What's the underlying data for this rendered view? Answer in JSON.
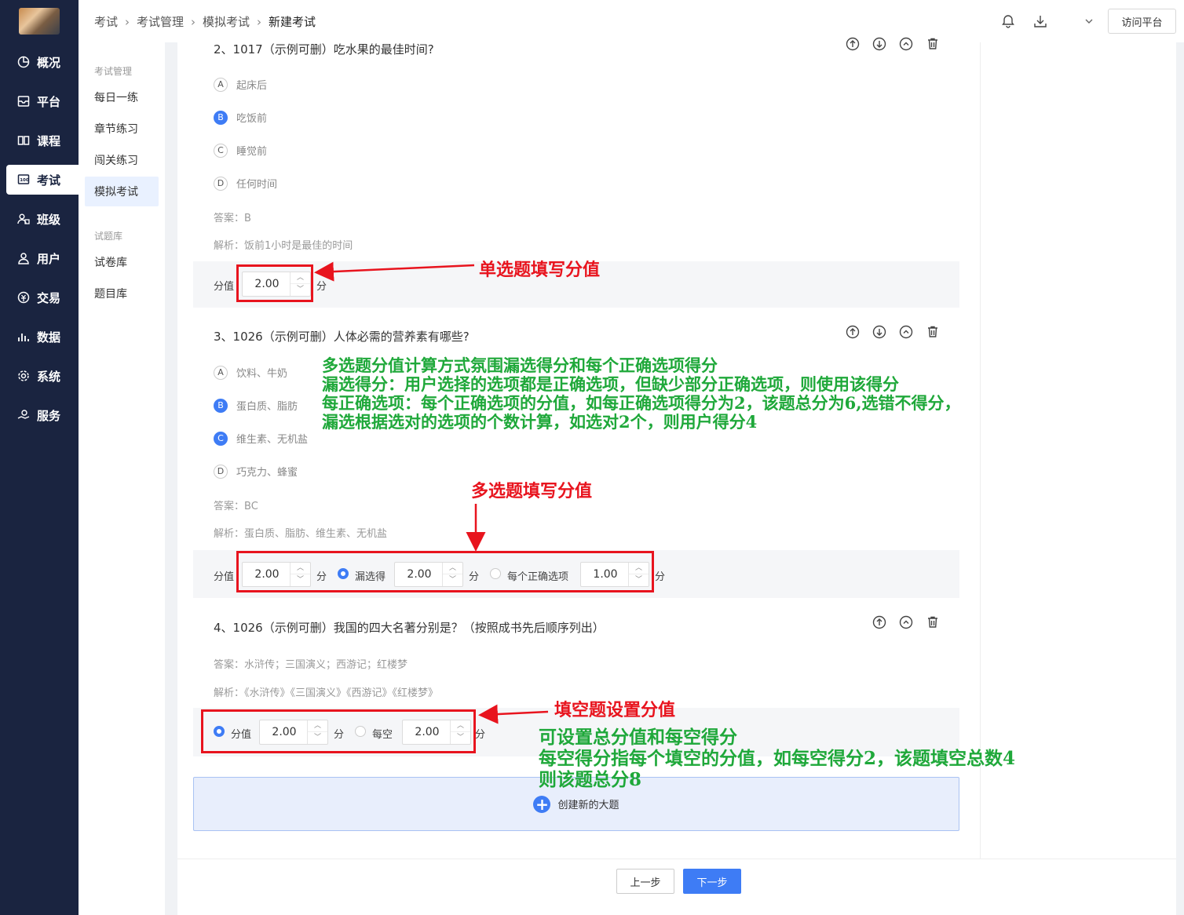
{
  "sidebar": {
    "items": [
      {
        "label": "概况",
        "icon": "chart-pie-icon"
      },
      {
        "label": "平台",
        "icon": "platform-icon"
      },
      {
        "label": "课程",
        "icon": "book-icon"
      },
      {
        "label": "考试",
        "icon": "exam-icon"
      },
      {
        "label": "班级",
        "icon": "class-icon"
      },
      {
        "label": "用户",
        "icon": "user-icon"
      },
      {
        "label": "交易",
        "icon": "trade-icon"
      },
      {
        "label": "数据",
        "icon": "data-bar-icon"
      },
      {
        "label": "系统",
        "icon": "gear-icon"
      },
      {
        "label": "服务",
        "icon": "service-icon"
      }
    ],
    "active": "考试"
  },
  "subnav": {
    "group1": "考试管理",
    "items1": [
      "每日一练",
      "章节练习",
      "闯关练习",
      "模拟考试"
    ],
    "group2": "试题库",
    "items2": [
      "试卷库",
      "题目库"
    ],
    "active": "模拟考试"
  },
  "header": {
    "breadcrumb": [
      "考试",
      "考试管理",
      "模拟考试",
      "新建考试"
    ],
    "visit_label": "访问平台"
  },
  "q2": {
    "title": "2、1017（示例可删）吃水果的最佳时间?",
    "options": [
      {
        "letter": "A",
        "text": "起床后",
        "correct": false
      },
      {
        "letter": "B",
        "text": "吃饭前",
        "correct": true
      },
      {
        "letter": "C",
        "text": "睡觉前",
        "correct": false
      },
      {
        "letter": "D",
        "text": "任何时间",
        "correct": false
      }
    ],
    "answer": "答案：B",
    "analysis": "解析：饭前1小时是最佳的时间",
    "score_label": "分值",
    "score": "2.00",
    "unit": "分"
  },
  "q3": {
    "title": "3、1026（示例可删）人体必需的营养素有哪些?",
    "options": [
      {
        "letter": "A",
        "text": "饮料、牛奶",
        "correct": false
      },
      {
        "letter": "B",
        "text": "蛋白质、脂肪",
        "correct": true
      },
      {
        "letter": "C",
        "text": "维生素、无机盐",
        "correct": true
      },
      {
        "letter": "D",
        "text": "巧克力、蜂蜜",
        "correct": false
      }
    ],
    "answer": "答案：BC",
    "analysis": "解析：蛋白质、脂肪、维生素、无机盐",
    "score_label": "分值",
    "score": "2.00",
    "unit": "分",
    "miss_label": "漏选得",
    "miss_score": "2.00",
    "each_label": "每个正确选项",
    "each_score": "1.00"
  },
  "q4": {
    "title": "4、1026（示例可删）我国的四大名著分别是？（按照成书先后顺序列出）",
    "answer": "答案：水浒传；三国演义；西游记；红楼梦",
    "analysis": "解析：《水浒传》《三国演义》《西游记》《红楼梦》",
    "score_label": "分值",
    "score": "2.00",
    "unit": "分",
    "each_blank_label": "每空",
    "each_blank_score": "2.00"
  },
  "annotations": {
    "single": "单选题填写分值",
    "multi_note": [
      "多选题分值计算方式氛围漏选得分和每个正确选项得分",
      "漏选得分：用户选择的选项都是正确选项，但缺少部分正确选项，则使用该得分",
      "每正确选项：每个正确选项的分值，如每正确选项得分为2，该题总分为6,选错不得分，",
      "漏选根据选对的选项的个数计算，如选对2个，则用户得分4"
    ],
    "multi": "多选题填写分值",
    "fill": "填空题设置分值",
    "fill_note": [
      "可设置总分值和每空得分",
      "每空得分指每个填空的分值，如每空得分2，该题填空总数4",
      "则该题总分8"
    ],
    "red": "#e8141e",
    "green": "#1fa83a"
  },
  "create_label": "创建新的大题",
  "footer": {
    "prev": "上一步",
    "next": "下一步"
  },
  "colors": {
    "primary": "#3e7cf5",
    "sidebar": "#1a2440"
  }
}
